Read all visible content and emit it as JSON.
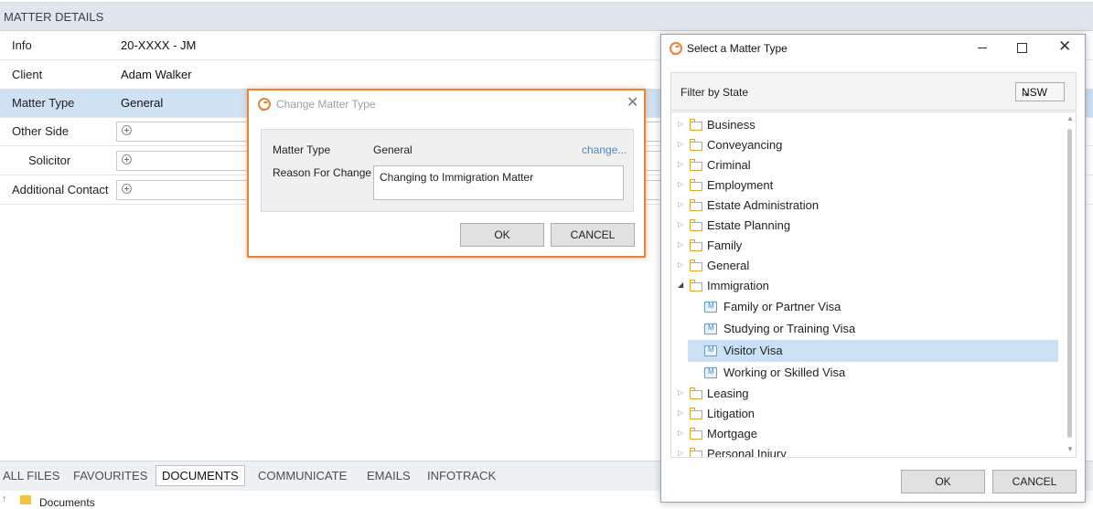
{
  "matter_details": {
    "header": "MATTER DETAILS",
    "rows": [
      {
        "label": "Info",
        "value": "20-XXXX - JM"
      },
      {
        "label": "Client",
        "value": "Adam Walker"
      },
      {
        "label": "Matter Type",
        "value": "General"
      },
      {
        "label": "Other Side",
        "value": ""
      },
      {
        "label": "Solicitor",
        "value": ""
      },
      {
        "label": "Additional Contact",
        "value": ""
      }
    ]
  },
  "tabs": [
    "ALL FILES",
    "FAVOURITES",
    "DOCUMENTS",
    "COMMUNICATE",
    "EMAILS",
    "INFOTRACK"
  ],
  "active_tab": "DOCUMENTS",
  "documents_row": {
    "label": "Documents"
  },
  "change_dialog": {
    "title": "Change Matter Type",
    "matter_type_label": "Matter Type",
    "matter_type_value": "General",
    "change_link": "change...",
    "reason_label": "Reason For Change",
    "reason_value": "Changing to Immigration Matter",
    "ok": "OK",
    "cancel": "CANCEL"
  },
  "select_window": {
    "title": "Select a Matter Type",
    "filter_label": "Filter by State",
    "state_value": "NSW",
    "tree": [
      {
        "label": "Business",
        "type": "folder",
        "expanded": false
      },
      {
        "label": "Conveyancing",
        "type": "folder",
        "expanded": false
      },
      {
        "label": "Criminal",
        "type": "folder",
        "expanded": false
      },
      {
        "label": "Employment",
        "type": "folder",
        "expanded": false
      },
      {
        "label": "Estate Administration",
        "type": "folder",
        "expanded": false
      },
      {
        "label": "Estate Planning",
        "type": "folder",
        "expanded": false
      },
      {
        "label": "Family",
        "type": "folder",
        "expanded": false
      },
      {
        "label": "General",
        "type": "folder",
        "expanded": false
      },
      {
        "label": "Immigration",
        "type": "folder",
        "expanded": true
      },
      {
        "label": "Family or Partner Visa",
        "type": "matter"
      },
      {
        "label": "Studying or Training Visa",
        "type": "matter"
      },
      {
        "label": "Visitor Visa",
        "type": "matter",
        "selected": true
      },
      {
        "label": "Working or Skilled Visa",
        "type": "matter"
      },
      {
        "label": "Leasing",
        "type": "folder",
        "expanded": false
      },
      {
        "label": "Litigation",
        "type": "folder",
        "expanded": false
      },
      {
        "label": "Mortgage",
        "type": "folder",
        "expanded": false
      },
      {
        "label": "Personal Injury",
        "type": "folder",
        "expanded": false
      }
    ],
    "ok": "OK",
    "cancel": "CANCEL"
  },
  "colors": {
    "accent": "#e8833a",
    "selection": "#cce0f5",
    "link": "#4a86c8"
  }
}
